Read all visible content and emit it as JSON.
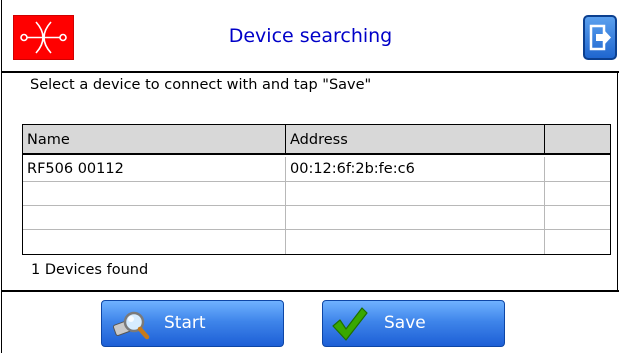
{
  "header": {
    "title": "Device searching"
  },
  "instruction": "Select a device to connect with and tap \"Save\"",
  "table": {
    "columns": [
      "Name",
      "Address",
      ""
    ],
    "rows": [
      [
        "RF506 00112",
        "00:12:6f:2b:fe:c6",
        ""
      ],
      [
        "",
        "",
        ""
      ],
      [
        "",
        "",
        ""
      ],
      [
        "",
        "",
        ""
      ]
    ]
  },
  "status": "1 Devices found",
  "buttons": {
    "start_label": "Start",
    "save_label": "Save"
  },
  "colors": {
    "title": "#0000c8",
    "logo_background": "#ff0000",
    "button_blue": "#3f85ea",
    "check_green": "#39a800"
  },
  "icons": {
    "logo": "sensor-logo-icon",
    "exit": "exit-icon",
    "start": "magnifier-icon",
    "save": "checkmark-icon"
  }
}
